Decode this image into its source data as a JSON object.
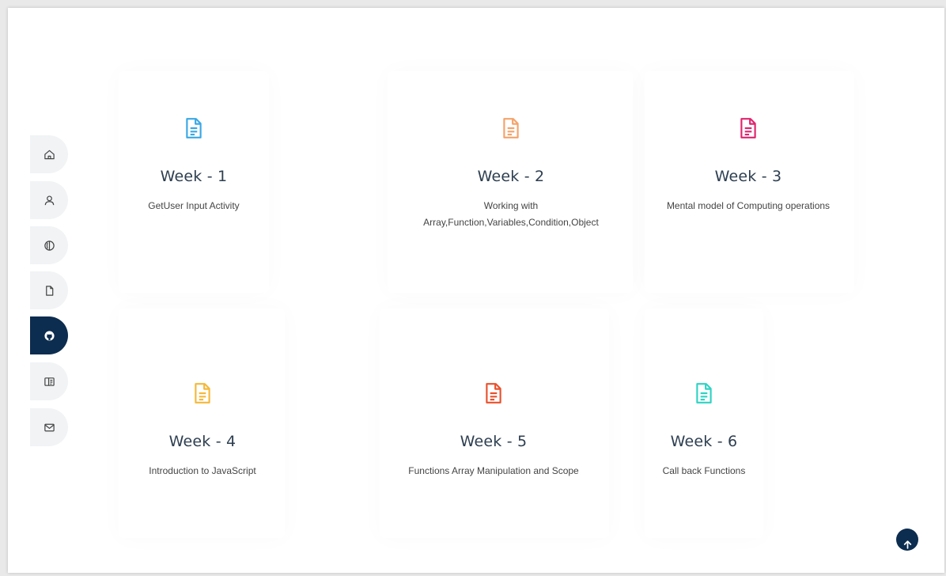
{
  "nav": {
    "items": [
      {
        "icon": "home-icon"
      },
      {
        "icon": "user-icon"
      },
      {
        "icon": "pen-tool-icon"
      },
      {
        "icon": "file-icon"
      },
      {
        "icon": "github-icon",
        "active": true
      },
      {
        "icon": "book-icon"
      },
      {
        "icon": "mail-icon"
      }
    ],
    "active_color": "#0c2d4f"
  },
  "weeks": [
    {
      "title": "Week - 1",
      "desc": "GetUser Input Activity",
      "icon_color": "#3aa8e6"
    },
    {
      "title": "Week - 2",
      "desc_line1": "Working with",
      "desc_line2": "Array,Function,Variables,Condition,Object",
      "icon_color": "#f5a36a"
    },
    {
      "title": "Week - 3",
      "desc": "Mental model of Computing operations",
      "icon_color": "#e0246d"
    },
    {
      "title": "Week - 4",
      "desc": "Introduction to JavaScript",
      "icon_color": "#f5b83a"
    },
    {
      "title": "Week - 5",
      "desc": "Functions Array Manipulation and Scope",
      "icon_color": "#e9512d"
    },
    {
      "title": "Week - 6",
      "desc": "Call back Functions",
      "icon_color": "#2fd3c4"
    }
  ],
  "back_to_top": {
    "icon": "arrow-up-icon"
  }
}
